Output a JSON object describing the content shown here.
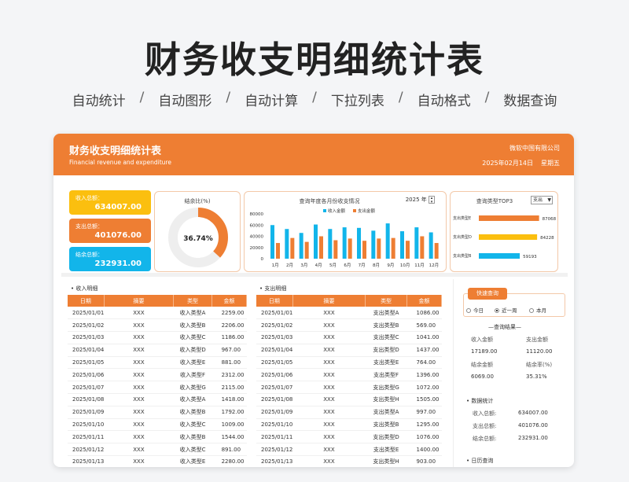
{
  "hero": {
    "title": "财务收支明细统计表",
    "features": [
      "自动统计",
      "自动图形",
      "自动计算",
      "下拉列表",
      "自动格式",
      "数据查询"
    ]
  },
  "header": {
    "title": "财务收支明细统计表",
    "subtitle": "Financial revenue and expenditure",
    "company": "微软中国有限公司",
    "date": "2025年02月14日",
    "weekday": "星期五"
  },
  "summary": {
    "income_label": "收入总额：",
    "income_value": "634007.00",
    "expense_label": "支出总额：",
    "expense_value": "401076.00",
    "balance_label": "结余总额：",
    "balance_value": "232931.00"
  },
  "colors": {
    "accent": "#ee7e33",
    "yellow": "#fbbf0f",
    "blue": "#12b5ea",
    "gray": "#eeeeee"
  },
  "donut": {
    "title": "结余比(%)",
    "value_label": "36.74%",
    "percent": 36.74
  },
  "monthly_chart": {
    "title": "查询年度各月份收支情况",
    "year": "2025",
    "year_unit": "年",
    "legend": [
      "收入金额",
      "支出金额"
    ],
    "chart_data": {
      "type": "bar",
      "categories": [
        "1月",
        "2月",
        "3月",
        "4月",
        "5月",
        "6月",
        "7月",
        "8月",
        "9月",
        "10月",
        "11月",
        "12月"
      ],
      "series": [
        {
          "name": "收入金额",
          "values": [
            60000,
            53000,
            46000,
            61000,
            53000,
            56000,
            55000,
            50000,
            63000,
            49000,
            56000,
            47000
          ]
        },
        {
          "name": "支出金额",
          "values": [
            28000,
            37000,
            30000,
            40000,
            33000,
            36000,
            32000,
            36000,
            37000,
            32000,
            40000,
            28000
          ]
        }
      ],
      "yticks": [
        "80000",
        "60000",
        "40000",
        "20000",
        "0"
      ],
      "ylim": [
        0,
        80000
      ]
    }
  },
  "top3": {
    "title": "查询类型TOP3",
    "selector": "支出",
    "chart_data": {
      "type": "bar",
      "categories": [
        "支出类型E",
        "支出类型D",
        "支出类型B"
      ],
      "values": [
        87068,
        84228,
        59193
      ],
      "value_labels": [
        "87068",
        "84228",
        "59193"
      ],
      "xlim": [
        0,
        100000
      ]
    }
  },
  "income_table": {
    "title": "收入明细",
    "headers": [
      "日期",
      "摘要",
      "类型",
      "金额"
    ],
    "rows": [
      [
        "2025/01/01",
        "XXX",
        "收入类型A",
        "2259.00"
      ],
      [
        "2025/01/02",
        "XXX",
        "收入类型B",
        "2206.00"
      ],
      [
        "2025/01/03",
        "XXX",
        "收入类型C",
        "1186.00"
      ],
      [
        "2025/01/04",
        "XXX",
        "收入类型D",
        "967.00"
      ],
      [
        "2025/01/05",
        "XXX",
        "收入类型E",
        "881.00"
      ],
      [
        "2025/01/06",
        "XXX",
        "收入类型F",
        "2312.00"
      ],
      [
        "2025/01/07",
        "XXX",
        "收入类型G",
        "2115.00"
      ],
      [
        "2025/01/08",
        "XXX",
        "收入类型A",
        "1418.00"
      ],
      [
        "2025/01/09",
        "XXX",
        "收入类型B",
        "1792.00"
      ],
      [
        "2025/01/10",
        "XXX",
        "收入类型C",
        "1009.00"
      ],
      [
        "2025/01/11",
        "XXX",
        "收入类型B",
        "1544.00"
      ],
      [
        "2025/01/12",
        "XXX",
        "收入类型C",
        "891.00"
      ],
      [
        "2025/01/13",
        "XXX",
        "收入类型E",
        "2280.00"
      ]
    ]
  },
  "expense_table": {
    "title": "支出明细",
    "headers": [
      "日期",
      "摘要",
      "类型",
      "金额"
    ],
    "rows": [
      [
        "2025/01/01",
        "XXX",
        "支出类型A",
        "1086.00"
      ],
      [
        "2025/01/02",
        "XXX",
        "支出类型B",
        "569.00"
      ],
      [
        "2025/01/03",
        "XXX",
        "支出类型C",
        "1041.00"
      ],
      [
        "2025/01/04",
        "XXX",
        "支出类型D",
        "1437.00"
      ],
      [
        "2025/01/05",
        "XXX",
        "支出类型E",
        "764.00"
      ],
      [
        "2025/01/06",
        "XXX",
        "支出类型F",
        "1396.00"
      ],
      [
        "2025/01/07",
        "XXX",
        "支出类型G",
        "1072.00"
      ],
      [
        "2025/01/08",
        "XXX",
        "支出类型H",
        "1505.00"
      ],
      [
        "2025/01/09",
        "XXX",
        "支出类型A",
        "997.00"
      ],
      [
        "2025/01/10",
        "XXX",
        "支出类型B",
        "1295.00"
      ],
      [
        "2025/01/11",
        "XXX",
        "支出类型D",
        "1076.00"
      ],
      [
        "2025/01/12",
        "XXX",
        "支出类型E",
        "1400.00"
      ],
      [
        "2025/01/13",
        "XXX",
        "支出类型H",
        "903.00"
      ]
    ]
  },
  "quick_query": {
    "button": "快速查询",
    "options": [
      "今日",
      "近一周",
      "本月"
    ],
    "selected": "近一周",
    "result_title": "—查询结果—",
    "income_label": "收入金额",
    "expense_label": "支出金额",
    "income_value": "17189.00",
    "expense_value": "11120.00",
    "balance_label": "结余金额",
    "ratio_label": "结余率(%)",
    "balance_value": "6069.00",
    "ratio_value": "35.31%"
  },
  "data_stats": {
    "title": "数据统计",
    "rows": [
      {
        "label": "收入总额:",
        "value": "634007.00"
      },
      {
        "label": "支出总额:",
        "value": "401076.00"
      },
      {
        "label": "结余总额:",
        "value": "232931.00"
      }
    ]
  },
  "daily_query": {
    "title": "日历查询"
  }
}
